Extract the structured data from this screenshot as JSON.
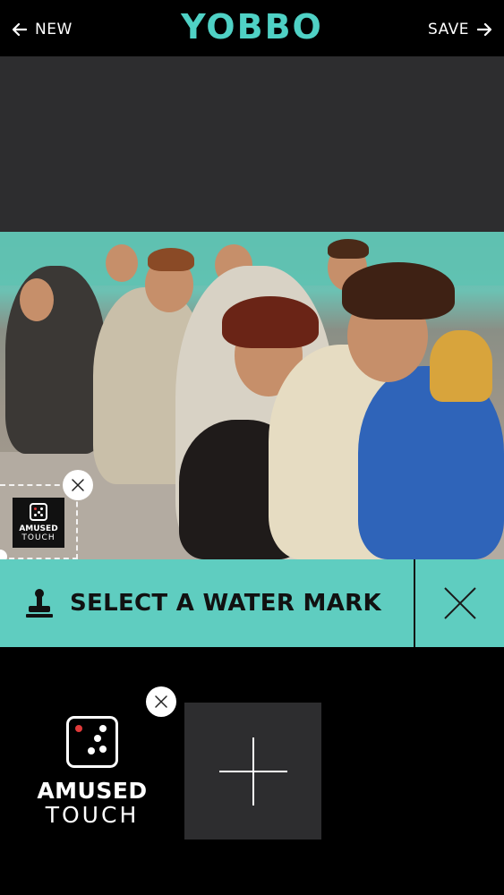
{
  "header": {
    "back_label": "NEW",
    "title": "YOBBO",
    "save_label": "SAVE"
  },
  "watermark_preview": {
    "logo_line1": "AMUSED",
    "logo_line2": "TOUCH"
  },
  "action_bar": {
    "select_label": "SELECT A WATER MARK"
  },
  "watermark_tray": {
    "items": [
      {
        "line1": "AMUSED",
        "line2": "TOUCH"
      }
    ]
  },
  "colors": {
    "accent": "#5fcdc0",
    "title": "#4fd1c5",
    "panel": "#2d2d2f",
    "background": "#000000"
  },
  "icons": [
    "arrow-left-icon",
    "arrow-right-icon",
    "stamp-icon",
    "close-icon",
    "plus-icon",
    "die-icon"
  ]
}
